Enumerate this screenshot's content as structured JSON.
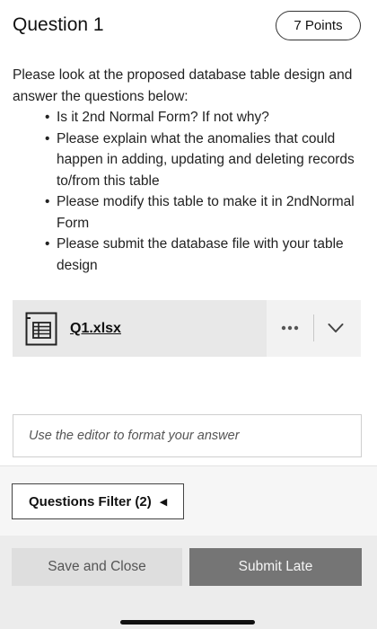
{
  "question": {
    "title": "Question 1",
    "points": "7 Points"
  },
  "prompt": {
    "intro": "Please look at the proposed database table design and answer the questions below:",
    "bullets": [
      "Is it 2nd Normal Form? If not why?",
      "Please explain what the anomalies that could happen in adding, updating and deleting records to/from this table",
      "Please modify this table to make it in 2ndNormal Form",
      "Please submit the database file with your table design"
    ]
  },
  "attachment": {
    "file_name": "Q1.xlsx",
    "icon": "spreadsheet-file-icon",
    "more_icon": "more-options-icon",
    "expand_icon": "chevron-down-icon"
  },
  "answer": {
    "placeholder": "Use the editor to format your answer"
  },
  "filter": {
    "label": "Questions Filter (2)",
    "arrow": "◀"
  },
  "actions": {
    "save_label": "Save and Close",
    "submit_label": "Submit Late"
  },
  "colors": {
    "attachment_bg": "#e8e8e8",
    "submit_bg": "#757575",
    "save_bg": "#dedede"
  }
}
